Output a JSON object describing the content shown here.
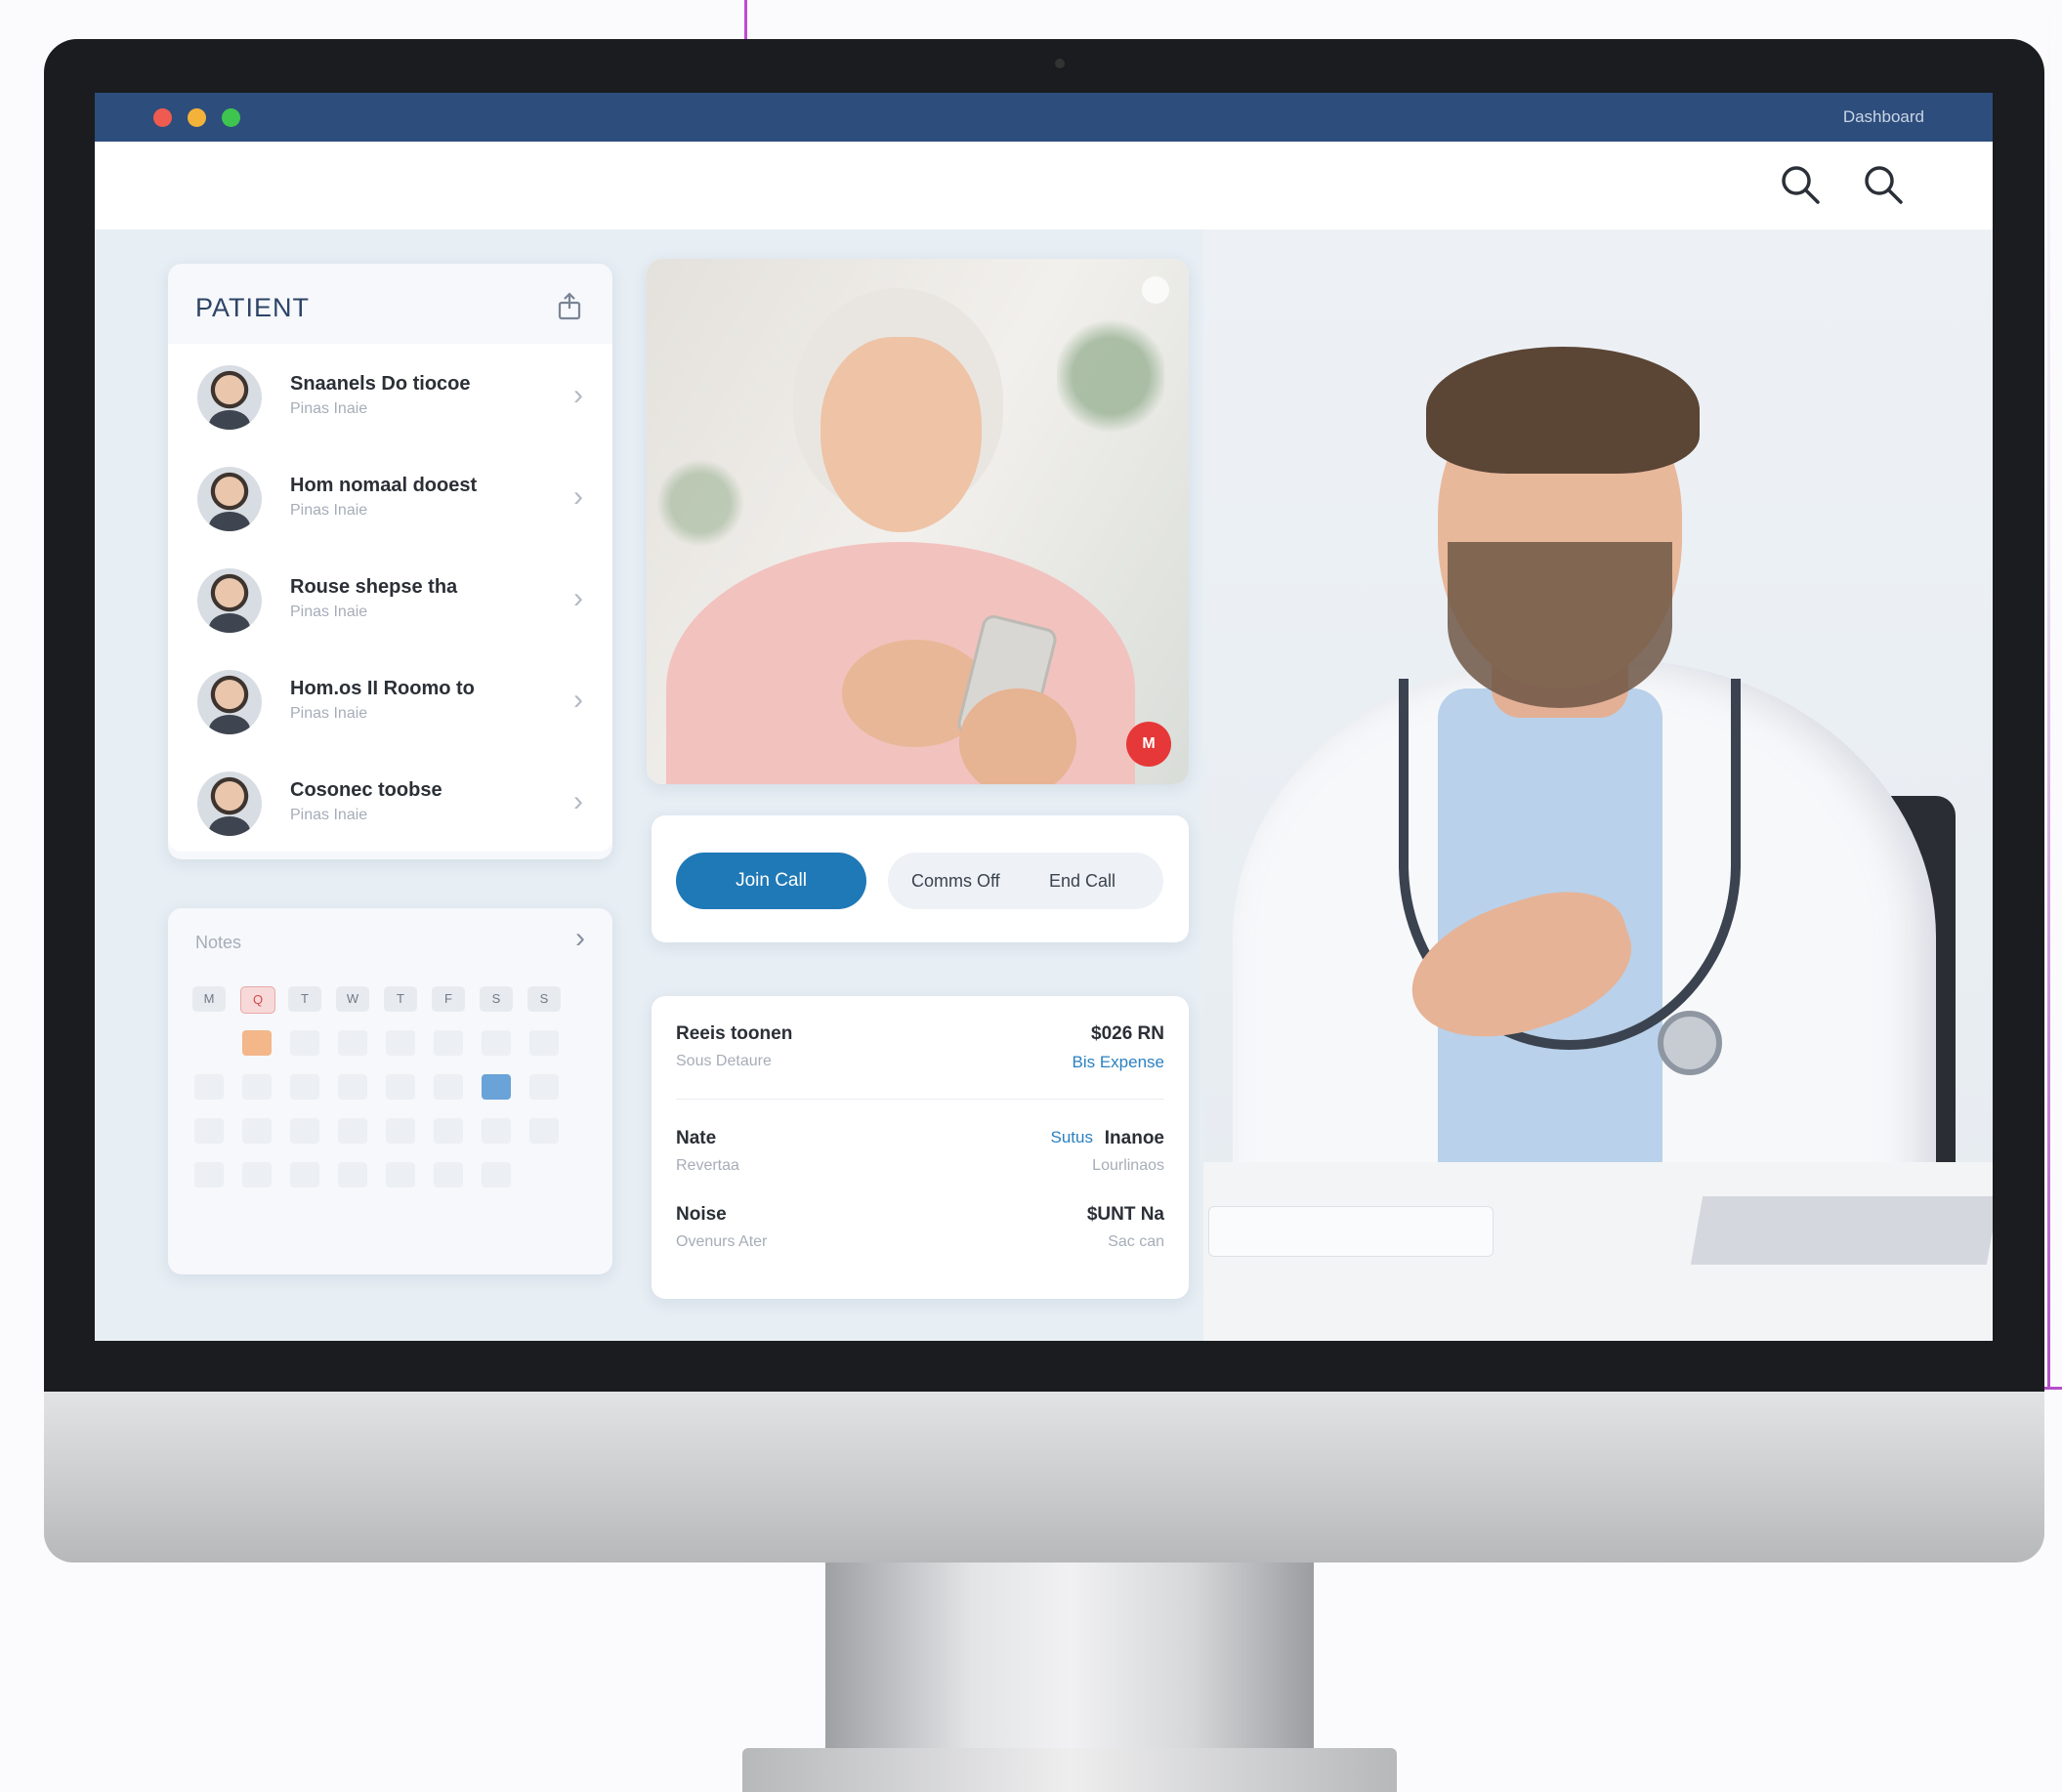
{
  "window": {
    "title": "Dashboard"
  },
  "toolbar": {
    "search_icons": [
      "search-icon",
      "search-icon"
    ]
  },
  "patients": {
    "header": "PATIENT",
    "items": [
      {
        "name": "Snaanels Do tiocoe",
        "sub": "Pinas Inaie"
      },
      {
        "name": "Hom nomaal dooest",
        "sub": "Pinas Inaie"
      },
      {
        "name": "Rouse shepse tha",
        "sub": "Pinas Inaie"
      },
      {
        "name": "Hom.os II Roomo to",
        "sub": "Pinas Inaie"
      },
      {
        "name": "Cosonec toobse",
        "sub": "Pinas Inaie"
      }
    ]
  },
  "calendar": {
    "title": "Notes",
    "days": [
      "M",
      "Q",
      "T",
      "W",
      "T",
      "F",
      "S",
      "S"
    ]
  },
  "video": {
    "badge": "M"
  },
  "call": {
    "join_label": "Join Call",
    "comms_label": "Comms Off",
    "end_label": "End Call"
  },
  "billing": {
    "rows": [
      {
        "title": "Reeis toonen",
        "sub": "Sous Detaure",
        "value": "$026 RN",
        "link": "Bis Expense"
      },
      {
        "title": "Nate",
        "sub": "Revertaa",
        "value": "Inanoe",
        "link": "Sutus",
        "right_sub": "Lourlinaos"
      },
      {
        "title": "Noise",
        "sub": "Ovenurs Ater",
        "value": "$UNT Na",
        "right_sub": "Sac can"
      }
    ]
  },
  "colors": {
    "title_bar": "#2d4d7c",
    "accent_blue": "#1f79b7",
    "alert_red": "#e63838"
  }
}
